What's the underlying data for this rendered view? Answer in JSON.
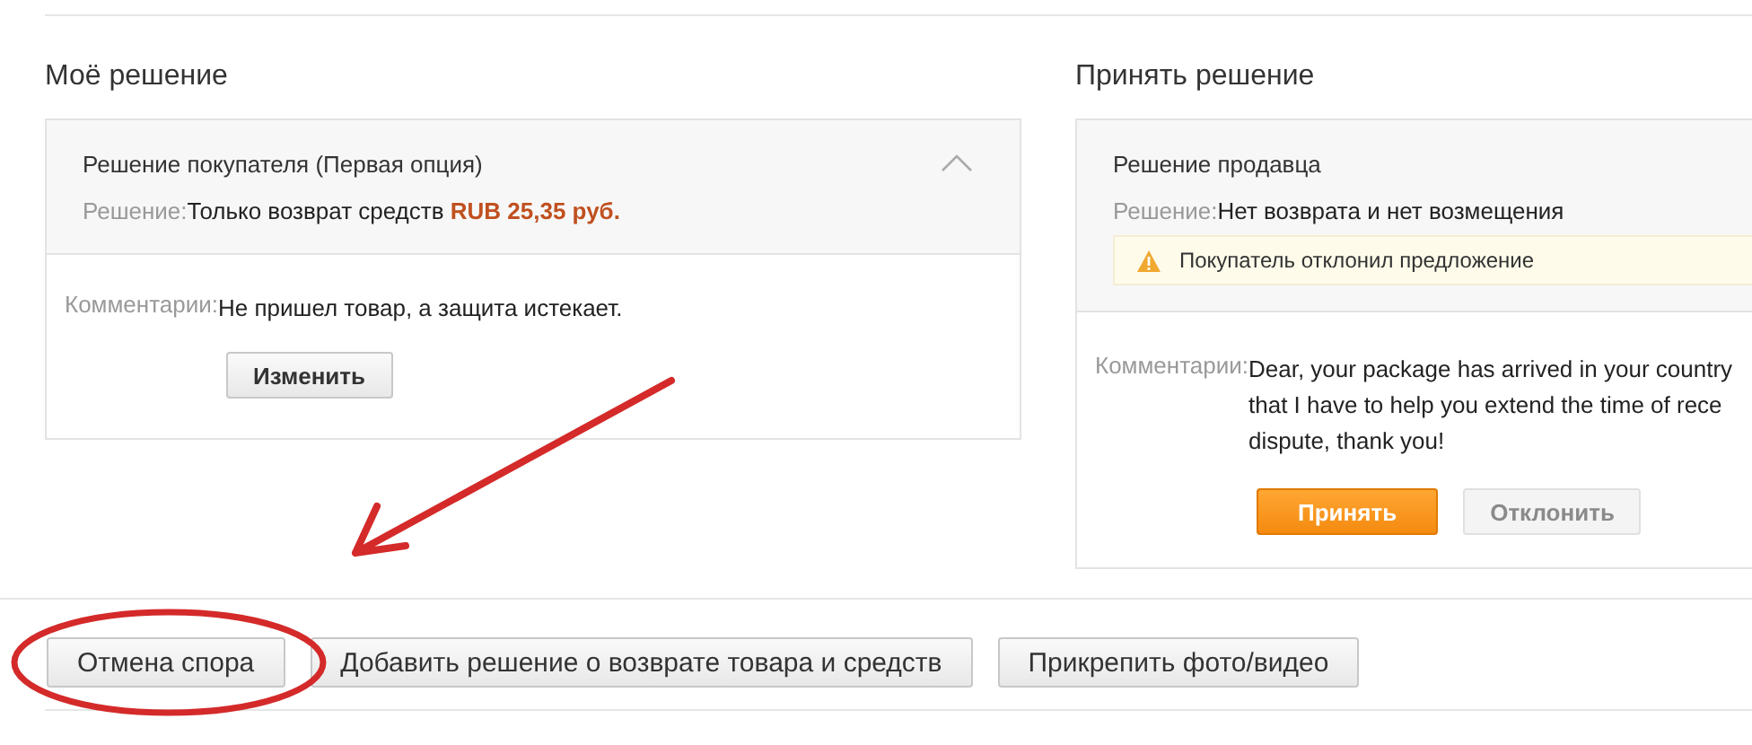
{
  "my_decision": {
    "heading": "Моё решение",
    "card": {
      "title": "Решение покупателя (Первая опция)",
      "expanded": true,
      "decision_label": "Решение:",
      "decision_text": "Только возврат средств ",
      "decision_amount": "RUB 25,35 руб.",
      "comment_label": "Комментарии:",
      "comment_lines": [
        "Не пришел товар, а защита истекает."
      ],
      "buttons": [
        {
          "label": "Изменить",
          "kind": "default",
          "disabled": false
        }
      ]
    }
  },
  "accept_decision": {
    "heading": "Принять решение",
    "card": {
      "title": "Решение продавца",
      "decision_label": "Решение:",
      "decision_text": "Нет возврата и нет возмещения",
      "warning": "Покупатель отклонил предложение",
      "comment_label": "Комментарии:",
      "comment_lines": [
        "Dear, your package has arrived in your country",
        "that I have to help you extend the time of rece",
        "dispute, thank you!"
      ],
      "buttons": [
        {
          "label": "Принять",
          "kind": "primary",
          "disabled": false
        },
        {
          "label": "Отклонить",
          "kind": "default",
          "disabled": true
        }
      ]
    }
  },
  "actions": [
    {
      "label": "Отмена спора"
    },
    {
      "label": "Добавить решение о возврате товара и средств"
    },
    {
      "label": "Прикрепить фото/видео"
    }
  ]
}
